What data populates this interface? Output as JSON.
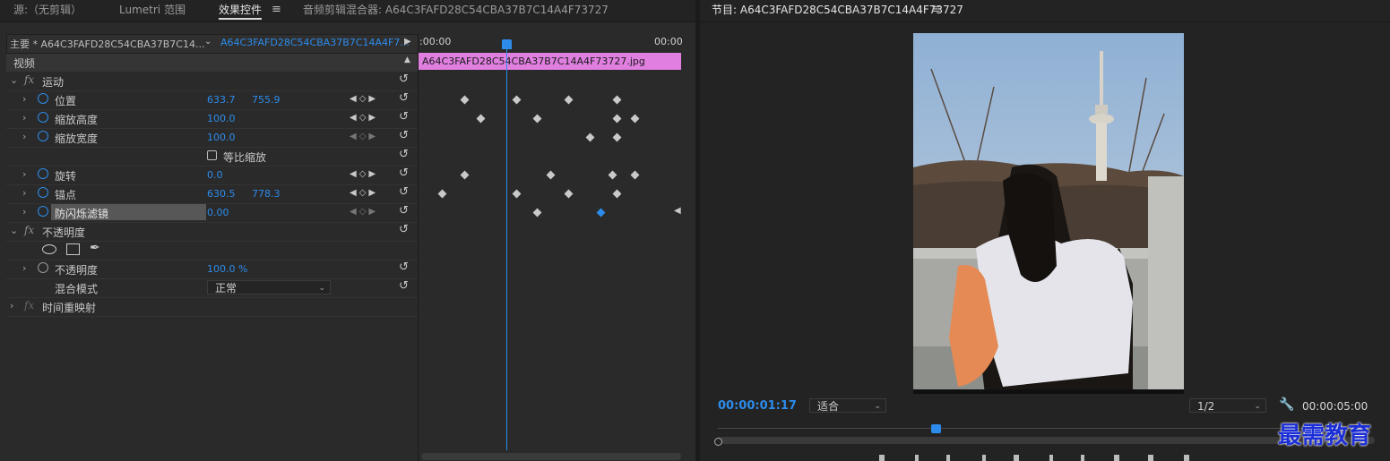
{
  "source_panel": {
    "tabs": [
      {
        "label": "源:（无剪辑）"
      },
      {
        "label": "Lumetri 范围"
      },
      {
        "label": "效果控件"
      },
      {
        "label": "音频剪辑混合器: A64C3FAFD28C54CBA37B7C14A4F73727"
      }
    ],
    "master_clip": "主要 * A64C3FAFD28C54CBA37B7C14...",
    "sequence_clip": "A64C3FAFD28C54CBA37B7C14A4F7...",
    "ruler_start": ":00:00",
    "ruler_end": "00:00",
    "clip_name": "A64C3FAFD28C54CBA37B7C14A4F73727.jpg",
    "section_video": "视频",
    "motion": {
      "label": "运动",
      "position": {
        "label": "位置",
        "x": "633.7",
        "y": "755.9"
      },
      "scale_height": {
        "label": "缩放高度",
        "value": "100.0"
      },
      "scale_width": {
        "label": "缩放宽度",
        "value": "100.0"
      },
      "uniform_scale": {
        "label": "等比缩放"
      },
      "rotation": {
        "label": "旋转",
        "value": "0.0"
      },
      "anchor": {
        "label": "锚点",
        "x": "630.5",
        "y": "778.3"
      },
      "anti_flicker": {
        "label": "防闪烁滤镜",
        "value": "0.00"
      }
    },
    "opacity": {
      "label": "不透明度",
      "opacity_row": {
        "label": "不透明度",
        "value": "100.0 %"
      },
      "blend_mode": {
        "label": "混合模式",
        "value": "正常"
      }
    },
    "time_remap": {
      "label": "时间重映射"
    }
  },
  "program_monitor": {
    "title": "节目: A64C3FAFD28C54CBA37B7C14A4F73727",
    "current_time": "00:00:01:17",
    "fit_label": "适合",
    "resolution": "1/2",
    "duration": "00:00:05:00"
  },
  "watermark": "最需教育",
  "colors": {
    "accent": "#2d8ceb",
    "clip": "#e07fe0",
    "panel": "#2a2a2a"
  }
}
